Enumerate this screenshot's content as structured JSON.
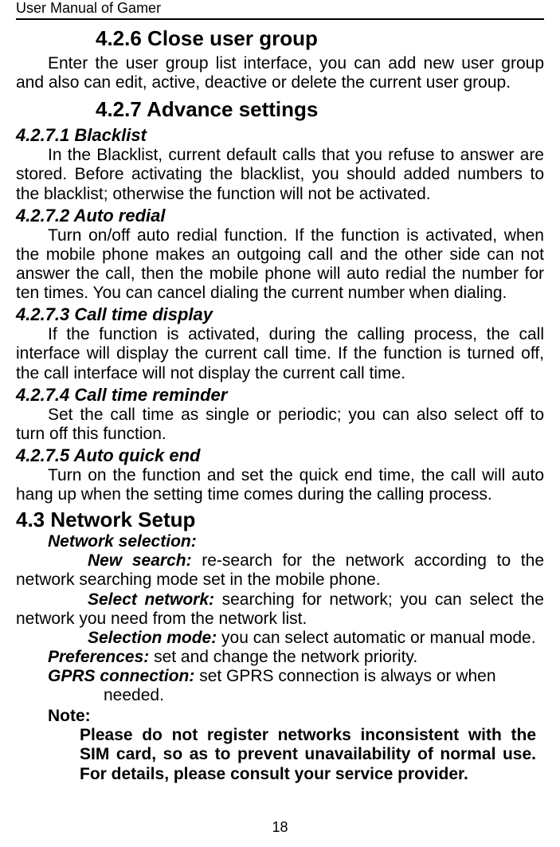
{
  "header": {
    "title": "User Manual of Gamer"
  },
  "s426": {
    "heading": "4.2.6 Close user group",
    "body": "Enter the user group list interface, you can add new user group and also can edit, active, deactive or delete the current user group."
  },
  "s427": {
    "heading": "4.2.7 Advance settings",
    "sub1": {
      "title": "4.2.7.1  Blacklist",
      "body": "In the Blacklist, current default calls that you refuse to answer are stored. Before activating the blacklist, you should added numbers to the blacklist; otherwise the function will not be activated."
    },
    "sub2": {
      "title": "4.2.7.2  Auto redial",
      "body": "Turn on/off auto redial function. If the function is activated, when the mobile phone makes an outgoing call and the other side can not answer the call, then the mobile phone will auto redial the number for ten times. You can cancel dialing the current number when dialing."
    },
    "sub3": {
      "title": "4.2.7.3  Call time display",
      "body": "If the function is activated, during the calling process, the call interface will display the current call time. If the function is turned off, the call interface will not display the current call time."
    },
    "sub4": {
      "title": "4.2.7.4  Call time reminder",
      "body": "Set the call time as single or periodic; you can also select off to turn off this function."
    },
    "sub5": {
      "title": "4.2.7.5  Auto quick end",
      "body": "Turn on the function and set the quick end time, the call will auto hang up when the setting time comes during the calling process."
    }
  },
  "s43": {
    "heading": "4.3   Network Setup",
    "netsel_label": "Network selection:",
    "newsearch_lead": "New search: ",
    "newsearch_body": "re-search for the network according to the network searching mode set in the mobile phone.",
    "selectnet_lead": "Select network: ",
    "selectnet_body": "searching for network; you can select the network you need from the network list.",
    "selmode_lead": "Selection mode: ",
    "selmode_body": "you can select automatic or manual mode.",
    "pref_lead": "Preferences: ",
    "pref_body": "set and change the network priority.",
    "gprs_lead": "GPRS connection: ",
    "gprs_body_line1": "set GPRS connection is always or when",
    "gprs_body_line2": "needed.",
    "note_label": "Note:",
    "note_body": "Please do not register networks inconsistent with the SIM card, so as to prevent unavailability of normal use. For details, please consult your service provider."
  },
  "page_number": "18"
}
